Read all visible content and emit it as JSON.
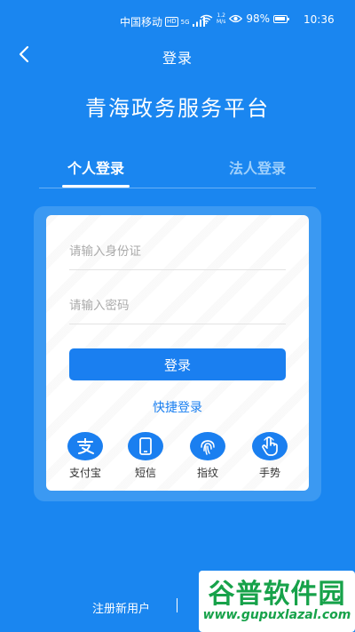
{
  "status_bar": {
    "carrier": "中国移动",
    "hd": "HD",
    "signal_type": "5G",
    "speed_value": "1.2",
    "speed_unit": "M/s",
    "battery": "98%",
    "time": "10:36"
  },
  "header": {
    "title": "登录",
    "platform_name": "青海政务服务平台"
  },
  "tabs": [
    {
      "label": "个人登录",
      "active": true
    },
    {
      "label": "法人登录",
      "active": false
    }
  ],
  "form": {
    "id_placeholder": "请输入身份证",
    "password_placeholder": "请输入密码",
    "login_label": "登录",
    "quick_login_label": "快捷登录"
  },
  "quick_methods": [
    {
      "label": "支付宝",
      "icon": "alipay-icon"
    },
    {
      "label": "短信",
      "icon": "phone-icon"
    },
    {
      "label": "指纹",
      "icon": "fingerprint-icon"
    },
    {
      "label": "手势",
      "icon": "gesture-icon"
    }
  ],
  "footer": {
    "register_label": "注册新用户"
  },
  "watermark": {
    "name": "谷普软件园",
    "url": "www.gupuxlazal.com"
  },
  "colors": {
    "background": "#1a86f0",
    "accent": "#1a7ff0",
    "card": "#ffffff"
  }
}
